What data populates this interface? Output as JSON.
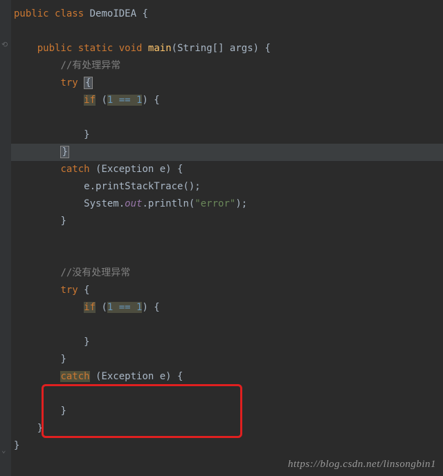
{
  "code": {
    "l1_public": "public",
    "l1_class": "class",
    "l1_name": "DemoIDEA",
    "l1_br": "{",
    "l2_public": "public",
    "l2_static": "static",
    "l2_void": "void",
    "l2_main": "main",
    "l2_sig_open": "(",
    "l2_string": "String",
    "l2_arr": "[]",
    "l2_args": " args",
    "l2_sig_close": ")",
    "l2_br": " {",
    "l3_comment": "//有处理异常",
    "l4_try": "try",
    "l4_br": "{",
    "l5_if": "if",
    "l5_open": " (",
    "l5_expr": "1 == 1",
    "l5_close": ") {",
    "l6_close": "}",
    "l7_close": "}",
    "l8_catch": "catch",
    "l8_open": " (",
    "l8_type": "Exception",
    "l8_var": " e",
    "l8_close": ") {",
    "l9_call": "e.printStackTrace();",
    "l10_sys": "System.",
    "l10_out": "out",
    "l10_println": ".println(",
    "l10_str": "\"error\"",
    "l10_end": ");",
    "l11_close": "}",
    "l12_comment": "//没有处理异常",
    "l13_try": "try",
    "l13_br": " {",
    "l14_if": "if",
    "l14_open": " (",
    "l14_expr": "1 == 1",
    "l14_close": ") {",
    "l15_close": "}",
    "l16_close": "}",
    "l17_catch": "catch",
    "l17_open": " (",
    "l17_type": "Exception",
    "l17_var": " e",
    "l17_close": ") {",
    "l18_close": "}",
    "l19_close": "}",
    "l20_close": "}"
  },
  "watermark": "https://blog.csdn.net/linsongbin1"
}
